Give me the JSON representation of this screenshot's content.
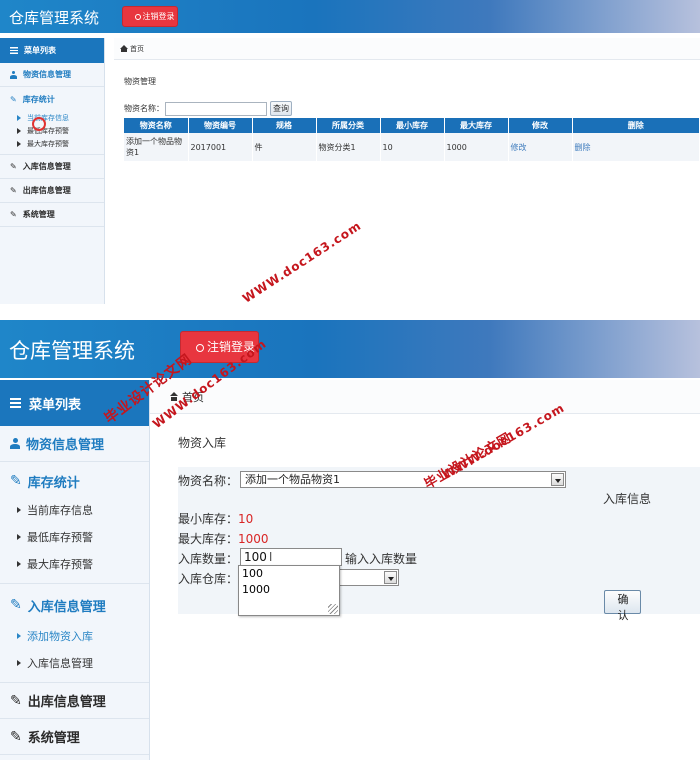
{
  "app": {
    "title": "仓库管理系统",
    "logout_label": "注销登录"
  },
  "sidebar": {
    "header": "菜单列表",
    "categories": {
      "materials": "物资信息管理",
      "stock": "库存统计",
      "inbound": "入库信息管理",
      "outbound": "出库信息管理",
      "system": "系统管理"
    },
    "stock_items": [
      "当前库存信息",
      "最低库存预警",
      "最大库存预警"
    ],
    "inbound_items": [
      "添加物资入库",
      "入库信息管理"
    ]
  },
  "breadcrumb": {
    "home": "首页"
  },
  "screen1": {
    "page_title": "物资管理",
    "search": {
      "label": "物资名称：",
      "value": "",
      "button": "查询"
    },
    "table": {
      "headers": [
        "物资名称",
        "物资编号",
        "规格",
        "所属分类",
        "最小库存",
        "最大库存",
        "修改",
        "删除"
      ],
      "rows": [
        [
          "添加一个物品物资1",
          "2017001",
          "件",
          "物资分类1",
          "10",
          "1000",
          "修改",
          "删除"
        ]
      ]
    }
  },
  "screen2": {
    "page_title": "物资入库",
    "section_label": "入库信息",
    "fields": {
      "material_label": "物资名称：",
      "material_value": "添加一个物品物资1",
      "min_stock_label": "最小库存：",
      "min_stock_value": "10",
      "max_stock_label": "最大库存：",
      "max_stock_value": "1000",
      "qty_label": "入库数量：",
      "qty_value": "100",
      "qty_hint": "输入入库数量",
      "warehouse_label": "入库仓库："
    },
    "autocomplete_options": [
      "100",
      "1000"
    ],
    "confirm_button": "确 认"
  },
  "watermarks": {
    "site": "WWW.doc163.com",
    "name": "毕业设计论文网"
  },
  "colors": {
    "header_blue": "#1a74bd",
    "logout_red": "#e8363f",
    "table_header": "#1a70b8",
    "highlight_red": "#d92525",
    "watermark_red": "#c5161d"
  }
}
